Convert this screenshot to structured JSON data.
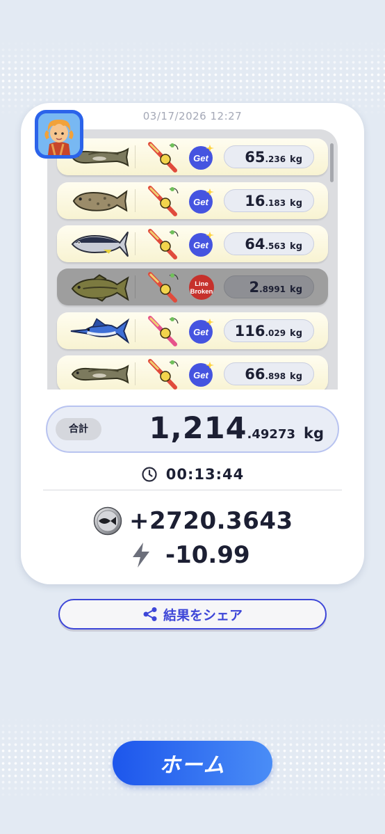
{
  "timestamp": "03/17/2026 12:27",
  "catches": [
    {
      "fish_icon": "eel-like-fish-icon",
      "status": "Get",
      "weight_int": "65",
      "weight_dec": ".236",
      "unit": "kg",
      "broken": false
    },
    {
      "fish_icon": "grouper-fish-icon",
      "status": "Get",
      "weight_int": "16",
      "weight_dec": ".183",
      "unit": "kg",
      "broken": false
    },
    {
      "fish_icon": "tuna-fish-icon",
      "status": "Get",
      "weight_int": "64",
      "weight_dec": ".563",
      "unit": "kg",
      "broken": false
    },
    {
      "fish_icon": "bass-fish-icon",
      "status": "Line Broken",
      "status_line1": "Line",
      "status_line2": "Broken",
      "weight_int": "2",
      "weight_dec": ".8991",
      "unit": "kg",
      "broken": true
    },
    {
      "fish_icon": "marlin-fish-icon",
      "status": "Get",
      "weight_int": "116",
      "weight_dec": ".029",
      "unit": "kg",
      "broken": false
    },
    {
      "fish_icon": "eel-like-fish-icon",
      "status": "Get",
      "weight_int": "66",
      "weight_dec": ".898",
      "unit": "kg",
      "broken": false
    }
  ],
  "total": {
    "label": "合計",
    "int": "1,214",
    "dec": ".49273",
    "unit": "kg"
  },
  "elapsed_time": "00:13:44",
  "coins": "+2720.3643",
  "energy": "-10.99",
  "share_label": "結果をシェア",
  "home_label": "ホーム",
  "colors": {
    "accent": "#3d46d8",
    "home_start": "#1d56ec",
    "home_end": "#4a8df6",
    "get_badge": "#4554e0",
    "broken_badge": "#c6312c"
  }
}
